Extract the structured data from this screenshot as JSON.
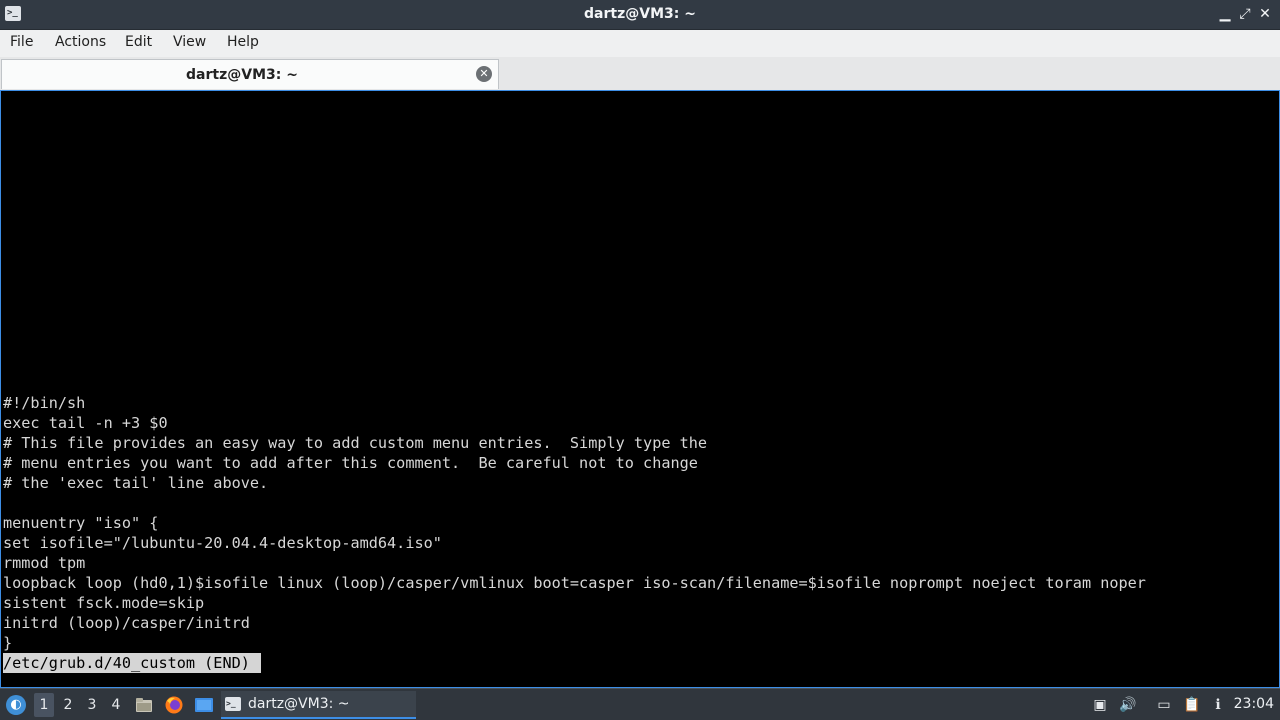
{
  "window": {
    "title": "dartz@VM3: ~",
    "app_icon": "terminal-icon",
    "controls": [
      "minimize-icon",
      "maximize-icon",
      "close-icon"
    ]
  },
  "menu": {
    "items": [
      "File",
      "Actions",
      "Edit",
      "View",
      "Help"
    ]
  },
  "tabs": [
    {
      "label": "dartz@VM3: ~",
      "close_icon": "close-circle-icon"
    }
  ],
  "terminal": {
    "lines": [
      "#!/bin/sh",
      "exec tail -n +3 $0",
      "# This file provides an easy way to add custom menu entries.  Simply type the",
      "# menu entries you want to add after this comment.  Be careful not to change",
      "# the 'exec tail' line above.",
      "",
      "menuentry \"iso\" {",
      "set isofile=\"/lubuntu-20.04.4-desktop-amd64.iso\"",
      "rmmod tpm",
      "loopback loop (hd0,1)$isofile linux (loop)/casper/vmlinux boot=casper iso-scan/filename=$isofile noprompt noeject toram noper",
      "sistent fsck.mode=skip",
      "initrd (loop)/casper/initrd",
      "}"
    ],
    "status": "/etc/grub.d/40_custom (END) "
  },
  "taskbar": {
    "launcher_icon": "lubuntu-menu-icon",
    "desktops": [
      "1",
      "2",
      "3",
      "4"
    ],
    "active_desktop": "1",
    "quicklaunch": [
      "file-manager-icon",
      "firefox-icon",
      "show-desktop-icon"
    ],
    "task": {
      "label": "dartz@VM3: ~",
      "icon": "terminal-icon"
    },
    "tray": [
      "screen-icon",
      "volume-icon",
      "network-icon",
      "clipboard-icon",
      "update-icon"
    ],
    "clock": "23:04"
  }
}
